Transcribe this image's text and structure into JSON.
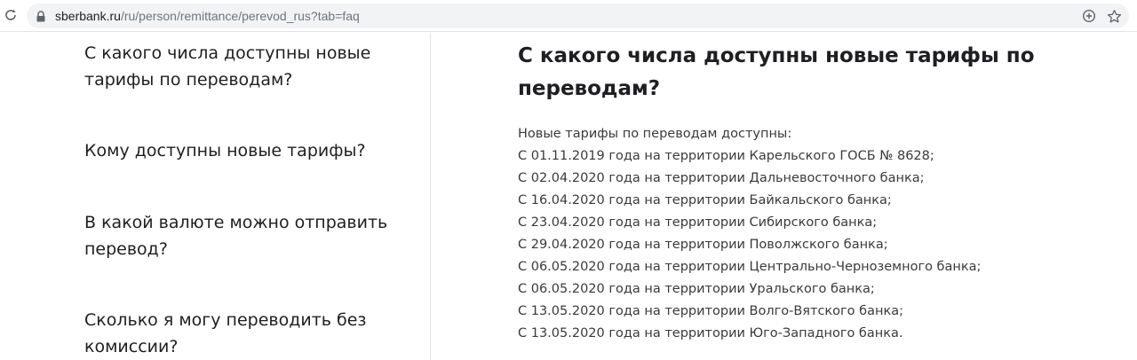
{
  "browser": {
    "url_host": "sberbank.ru",
    "url_path": "/ru/person/remittance/perevod_rus?tab=faq",
    "icons": [
      "reload-icon",
      "lock-icon",
      "add-icon",
      "bookmark-star-icon"
    ]
  },
  "faq": {
    "questions": [
      "С какого числа доступны новые тарифы по переводам?",
      "Кому доступны новые тарифы?",
      "В какой валюте можно отправить перевод?",
      "Сколько я могу переводить без комиссии?"
    ]
  },
  "answer": {
    "title": "С какого числа доступны новые тарифы по переводам?",
    "intro": "Новые тарифы по переводам доступны:",
    "lines": [
      "С 01.11.2019 года на территории Карельского ГОСБ № 8628;",
      "С 02.04.2020 года на территории Дальневосточного банка;",
      "С 16.04.2020 года на территории Байкальского банка;",
      "С 23.04.2020 года на территории Сибирского банка;",
      "С 29.04.2020 года на территории Поволжского банка;",
      "С 06.05.2020 года на территории Центрально-Черноземного банка;",
      "С 06.05.2020 года на территории Уральского банка;",
      "С 13.05.2020 года на территории Волго-Вятского банка;",
      "С 13.05.2020 года на территории Юго-Западного банка."
    ]
  }
}
